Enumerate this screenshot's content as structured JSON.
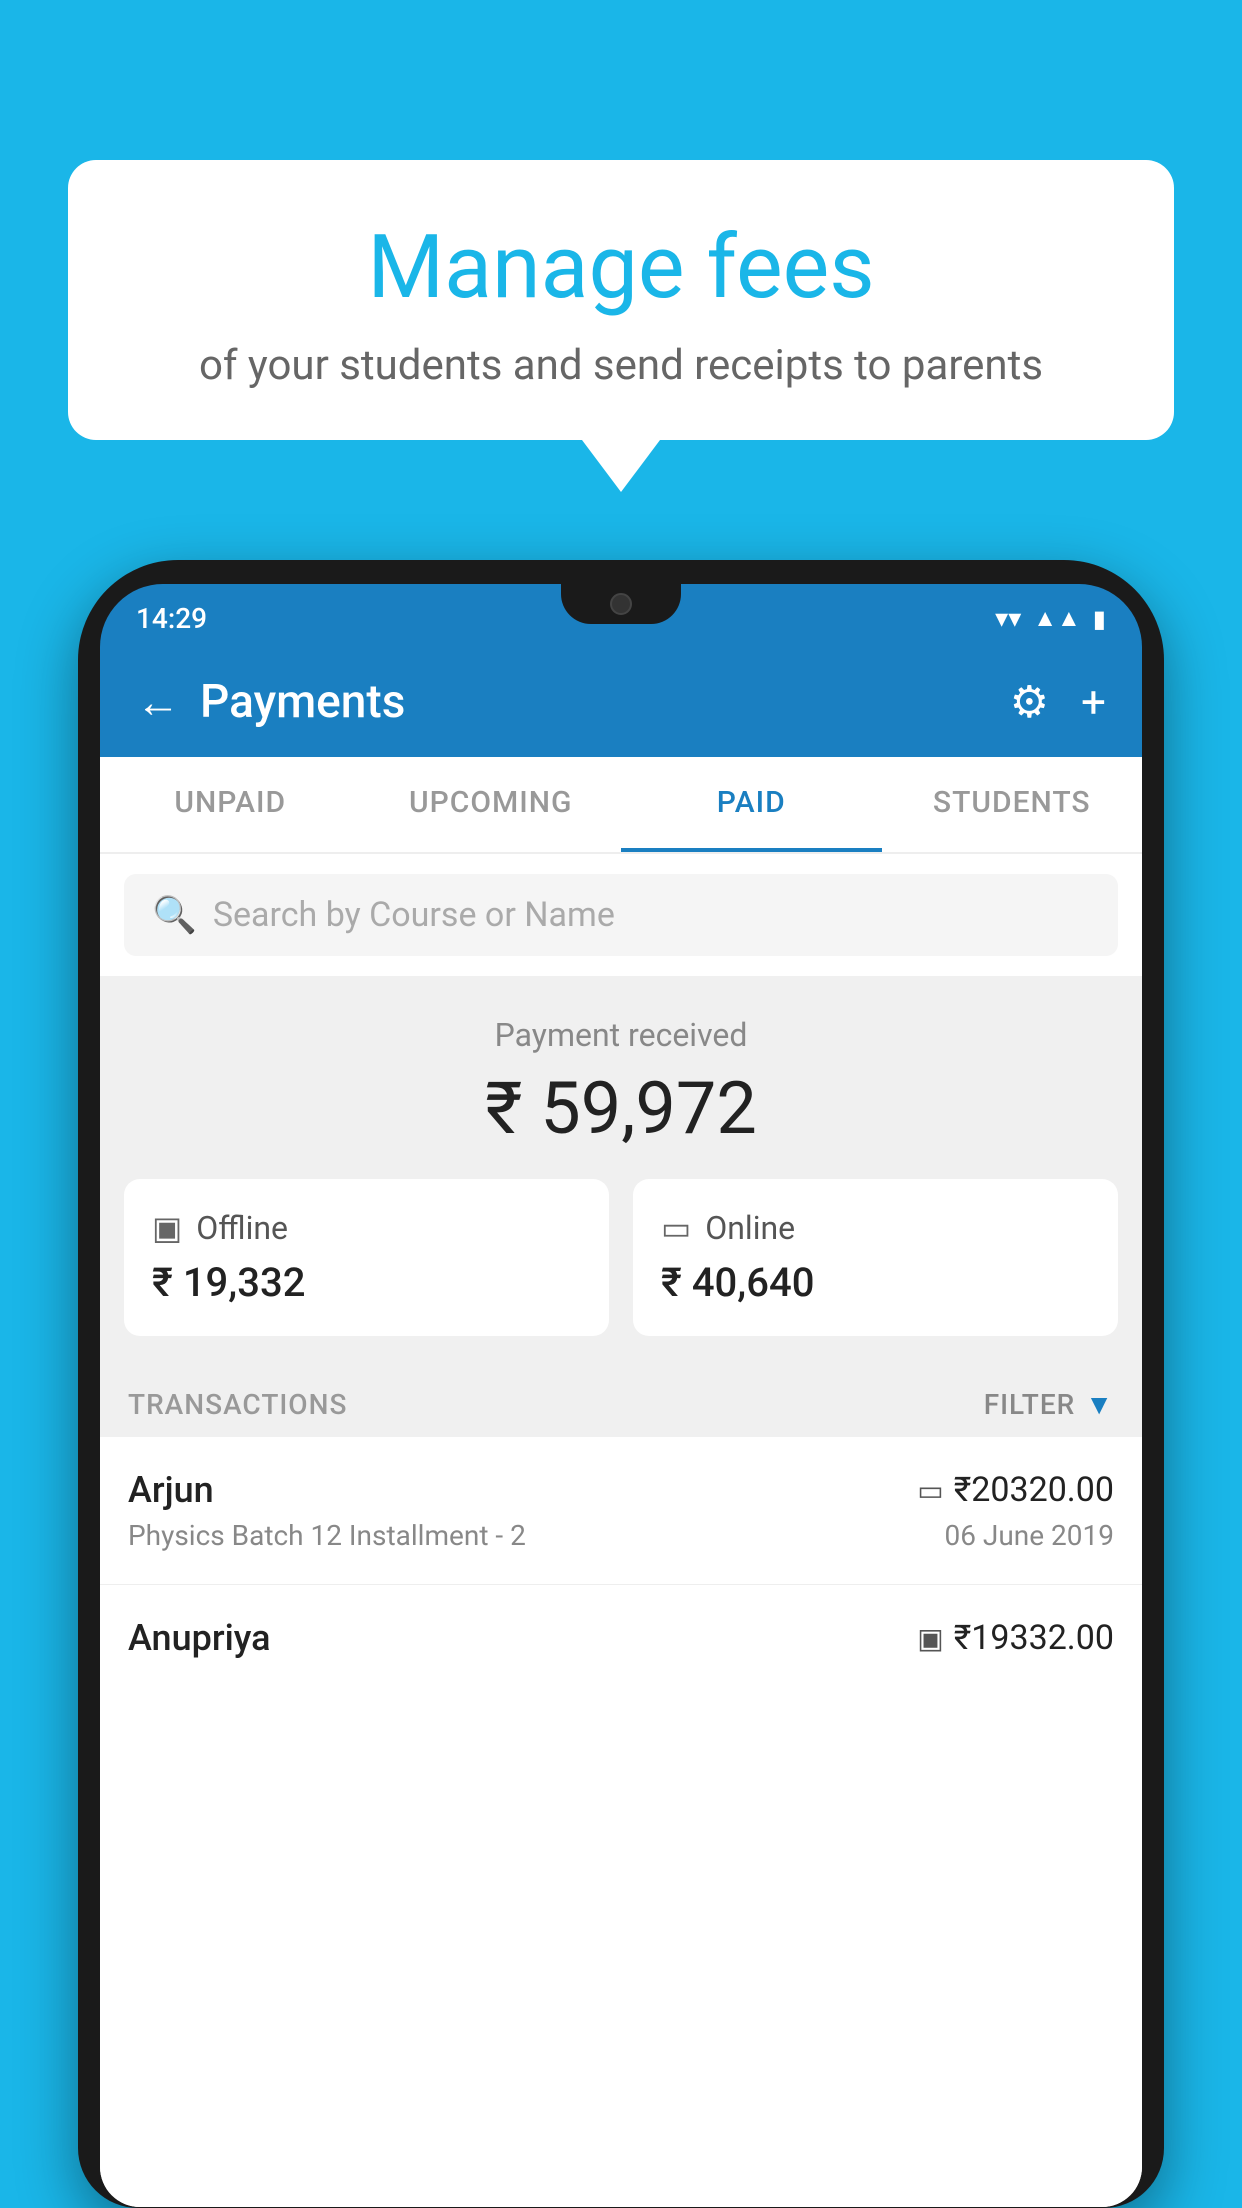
{
  "background_color": "#1ab6e8",
  "speech_bubble": {
    "title": "Manage fees",
    "subtitle": "of your students and send receipts to parents"
  },
  "phone": {
    "status_bar": {
      "time": "14:29",
      "icons": [
        "wifi",
        "signal",
        "battery"
      ]
    },
    "header": {
      "back_label": "←",
      "title": "Payments",
      "settings_icon": "⚙",
      "add_icon": "+"
    },
    "tabs": [
      {
        "label": "UNPAID",
        "active": false
      },
      {
        "label": "UPCOMING",
        "active": false
      },
      {
        "label": "PAID",
        "active": true
      },
      {
        "label": "STUDENTS",
        "active": false
      }
    ],
    "search": {
      "placeholder": "Search by Course or Name"
    },
    "payment_summary": {
      "label": "Payment received",
      "amount": "₹ 59,972",
      "offline": {
        "type": "Offline",
        "amount": "₹ 19,332"
      },
      "online": {
        "type": "Online",
        "amount": "₹ 40,640"
      }
    },
    "transactions": {
      "header": "TRANSACTIONS",
      "filter": "FILTER",
      "items": [
        {
          "name": "Arjun",
          "amount": "₹20320.00",
          "payment_type": "card",
          "description": "Physics Batch 12 Installment - 2",
          "date": "06 June 2019"
        },
        {
          "name": "Anupriya",
          "amount": "₹19332.00",
          "payment_type": "offline",
          "description": "",
          "date": ""
        }
      ]
    }
  }
}
